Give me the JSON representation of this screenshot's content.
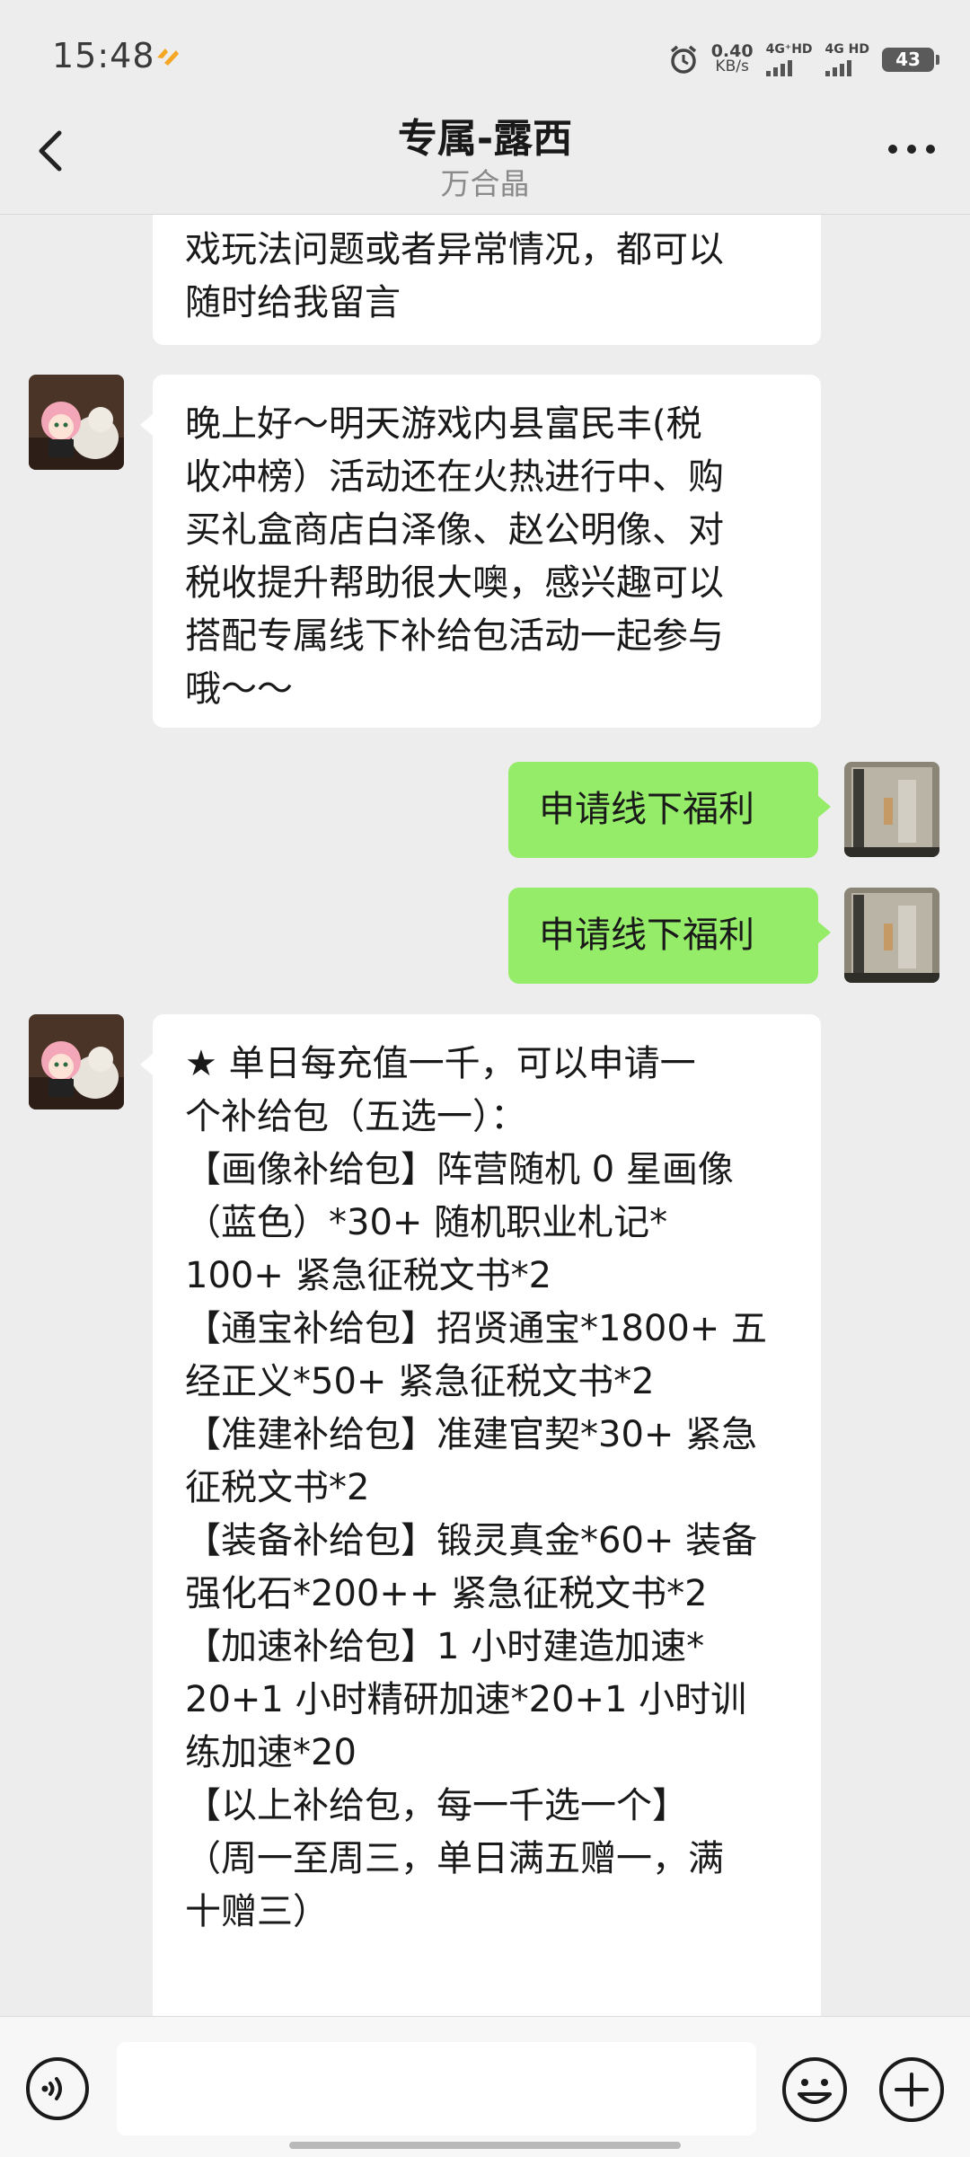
{
  "status_bar": {
    "time": "15:48",
    "speed_value": "0.40",
    "speed_unit": "KB/s",
    "network_1": "4G⁺HD",
    "network_2": "4G HD",
    "battery": "43"
  },
  "header": {
    "title": "专属-露西",
    "subtitle": "万合晶"
  },
  "messages": [
    {
      "side": "in",
      "text": "戏玩法问题或者异常情况，都可以\n随时给我留言"
    },
    {
      "side": "in",
      "text": "晚上好～明天游戏内县富民丰(税\n收冲榜）活动还在火热进行中、购\n买礼盒商店白泽像、赵公明像、对\n税收提升帮助很大噢，感兴趣可以\n搭配专属线下补给包活动一起参与\n哦～～"
    },
    {
      "side": "out",
      "text": "申请线下福利"
    },
    {
      "side": "out",
      "text": "申请线下福利"
    },
    {
      "side": "in",
      "text": "★ 单日每充值一千，可以申请一\n个补给包（五选一）：\n【画像补给包】阵营随机 0 星画像\n（蓝色）*30+ 随机职业札记*\n100+ 紧急征税文书*2\n【通宝补给包】招贤通宝*1800+ 五\n经正义*50+ 紧急征税文书*2\n【准建补给包】准建官契*30+ 紧急\n征税文书*2\n【装备补给包】锻灵真金*60+ 装备\n强化石*200++ 紧急征税文书*2\n【加速补给包】1 小时建造加速*\n20+1 小时精研加速*20+1 小时训\n练加速*20\n【以上补给包，每一千选一个】\n（周一至周三，单日满五赠一，满\n十赠三）"
    }
  ],
  "input": {
    "placeholder": ""
  },
  "colors": {
    "background": "#ededed",
    "outgoing_bubble": "#95ec69",
    "incoming_bubble": "#ffffff"
  },
  "icons": {
    "back": "chevron-left-icon",
    "more": "more-dots-icon",
    "voice": "voice-icon",
    "emoji": "emoji-icon",
    "plus": "plus-icon"
  }
}
